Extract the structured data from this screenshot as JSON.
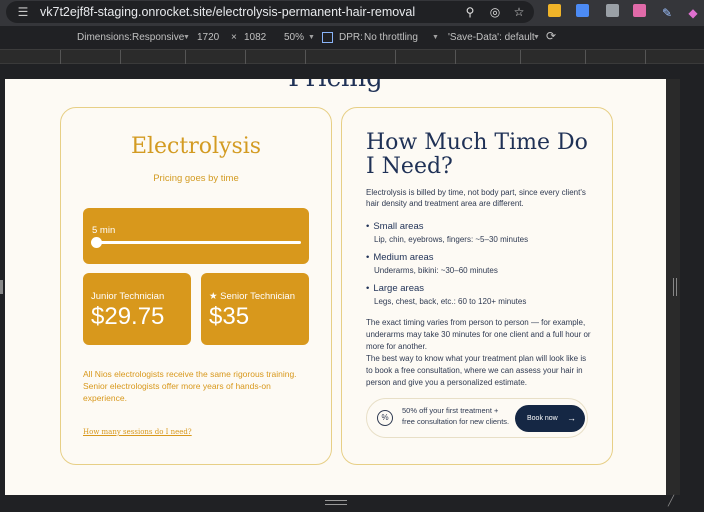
{
  "browser": {
    "url": "vk7t2ejf8f-staging.onrocket.site/electrolysis-permanent-hair-removal"
  },
  "device_toolbar": {
    "dimensions_label": "Dimensions:",
    "dimensions_mode": "Responsive",
    "width": "1720",
    "times": "×",
    "height": "1082",
    "zoom": "50%",
    "dpr_label": "DPR:",
    "throttling": "No throttling",
    "save_data": "'Save-Data': default"
  },
  "page": {
    "section_heading": "Pricing",
    "left_card": {
      "title": "Electrolysis",
      "subtitle": "Pricing goes by time",
      "slider_label": "5 min",
      "slider_level": 0,
      "junior": {
        "label": "Junior Technician",
        "price": "$29.75"
      },
      "senior": {
        "label": "★ Senior Technician",
        "price": "$35"
      },
      "note": "All Nios electrologists receive the same rigorous training. Senior electrologists offer more years of hands-on experience.",
      "link": "How many sessions do I need?"
    },
    "right_card": {
      "title": "How Much Time Do I Need?",
      "intro": "Electrolysis is billed by time, not body part, since every client's hair density and treatment area are different.",
      "areas": [
        {
          "bullet": "•",
          "name": "Small areas",
          "desc": "Lip, chin, eyebrows, fingers: ~5–30 minutes"
        },
        {
          "bullet": "•",
          "name": "Medium areas",
          "desc": "Underarms, bikini: ~30–60 minutes"
        },
        {
          "bullet": "•",
          "name": "Large areas",
          "desc": "Legs, chest, back, etc.: 60 to 120+ minutes"
        }
      ],
      "para1": "The exact timing varies from person to person — for example, underarms may take 30 minutes for one client and a full hour or more for another.",
      "para2": "The best way to know what your treatment plan will look like is to book a free consultation, where we can assess your hair in person and give you a personalized estimate.",
      "promo_text": "50% off your first treatment + free consultation for new clients.",
      "book_label": "Book now",
      "book_arrow": "→"
    }
  },
  "colors": {
    "gold": "#d8981c",
    "navy": "#1f3156",
    "background": "#fdfaf4"
  }
}
